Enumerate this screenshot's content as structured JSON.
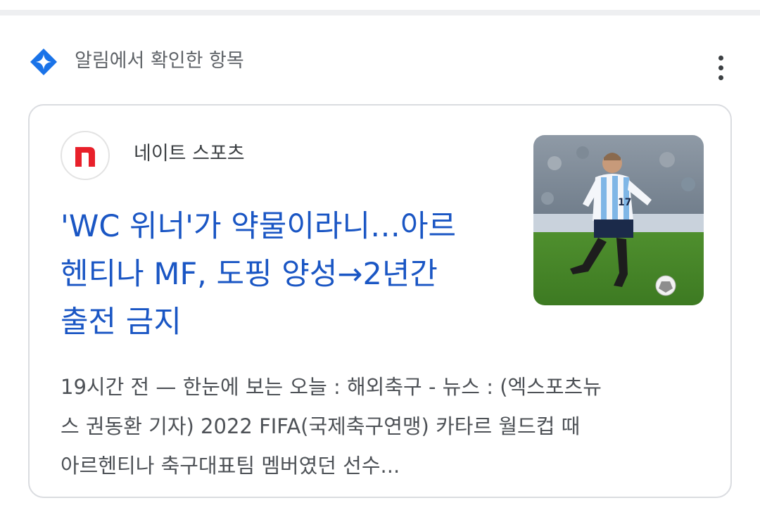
{
  "section": {
    "title": "알림에서 확인한 항목",
    "icon": "discover-sparkle-icon",
    "icon_color": "#1a73e8",
    "menu_icon": "more-vert-icon"
  },
  "article": {
    "source": {
      "name": "네이트 스포츠",
      "logo_letter": "n",
      "logo_color": "#e8202a"
    },
    "headline_lines": [
      "'WC 위너'가 약물이라니…아르",
      "헨티나 MF, 도핑 양성→2년간",
      "출전 금지"
    ],
    "headline_color": "#1a56c4",
    "snippet_lines": [
      "19시간 전 — 한눈에 보는 오늘 : 해외축구 - 뉴스 : (엑스포츠뉴",
      "스 권동환 기자) 2022 FIFA(국제축구연맹) 카타르 월드컵 때",
      "아르헨티나 축구대표팀 멤버였던 선수..."
    ],
    "thumbnail": {
      "subject": "soccer-player-photo",
      "jersey_number": "17"
    }
  }
}
